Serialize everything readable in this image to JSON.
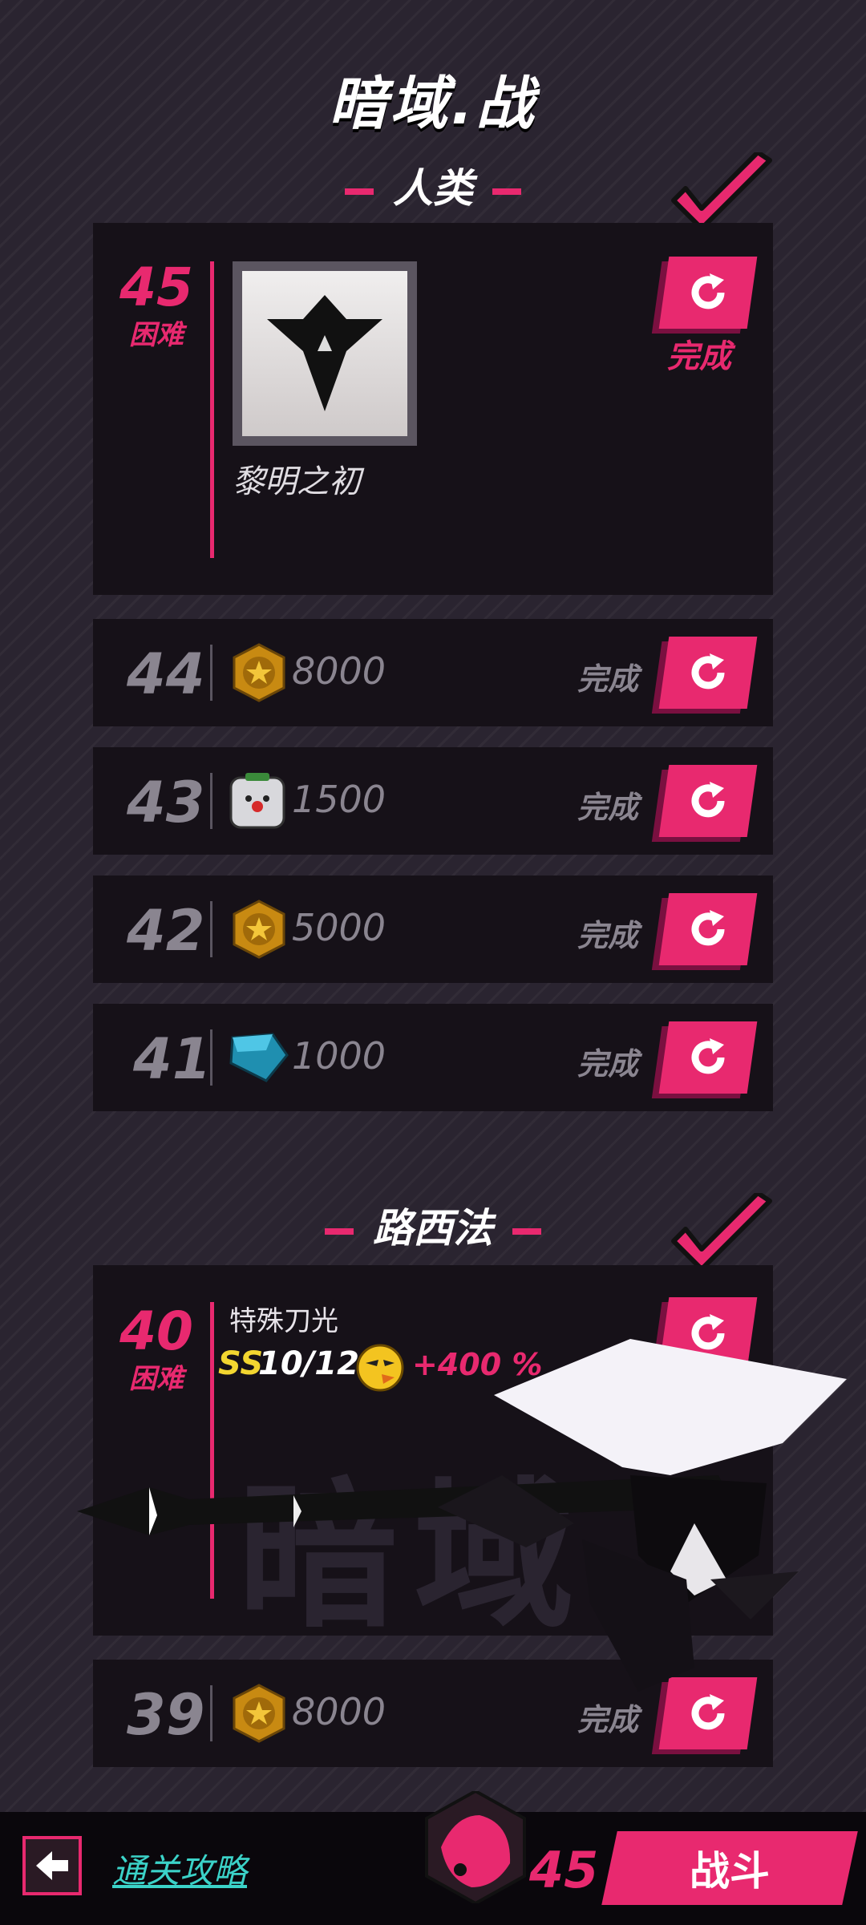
{
  "page_title": "暗域.战",
  "sections": [
    {
      "label": "人类"
    },
    {
      "label": "路西法"
    }
  ],
  "featured_top": {
    "level": "45",
    "difficulty": "困难",
    "item_name": "黎明之初",
    "status": "完成"
  },
  "levels_top": [
    {
      "level": "44",
      "reward_icon": "gold-star-coin-icon",
      "amount": "8000",
      "status": "完成"
    },
    {
      "level": "43",
      "reward_icon": "ghost-avatar-icon",
      "amount": "1500",
      "status": "完成"
    },
    {
      "level": "42",
      "reward_icon": "gold-star-coin-icon",
      "amount": "5000",
      "status": "完成"
    },
    {
      "level": "41",
      "reward_icon": "blue-gem-icon",
      "amount": "1000",
      "status": "完成"
    }
  ],
  "featured_bottom": {
    "level": "40",
    "difficulty": "困难",
    "effect_name": "特殊刀光",
    "rank": "SS",
    "progress": "10/12",
    "bonus": "+400 %",
    "watermark": "暗域"
  },
  "level_39": {
    "level": "39",
    "reward_icon": "gold-star-coin-icon",
    "amount": "8000",
    "status": "完成"
  },
  "footer": {
    "guide_label": "通关攻略",
    "energy": "45",
    "fight_label": "战斗"
  },
  "colors": {
    "accent": "#e8296f",
    "panel": "#161118",
    "guide": "#3bd2c8"
  }
}
